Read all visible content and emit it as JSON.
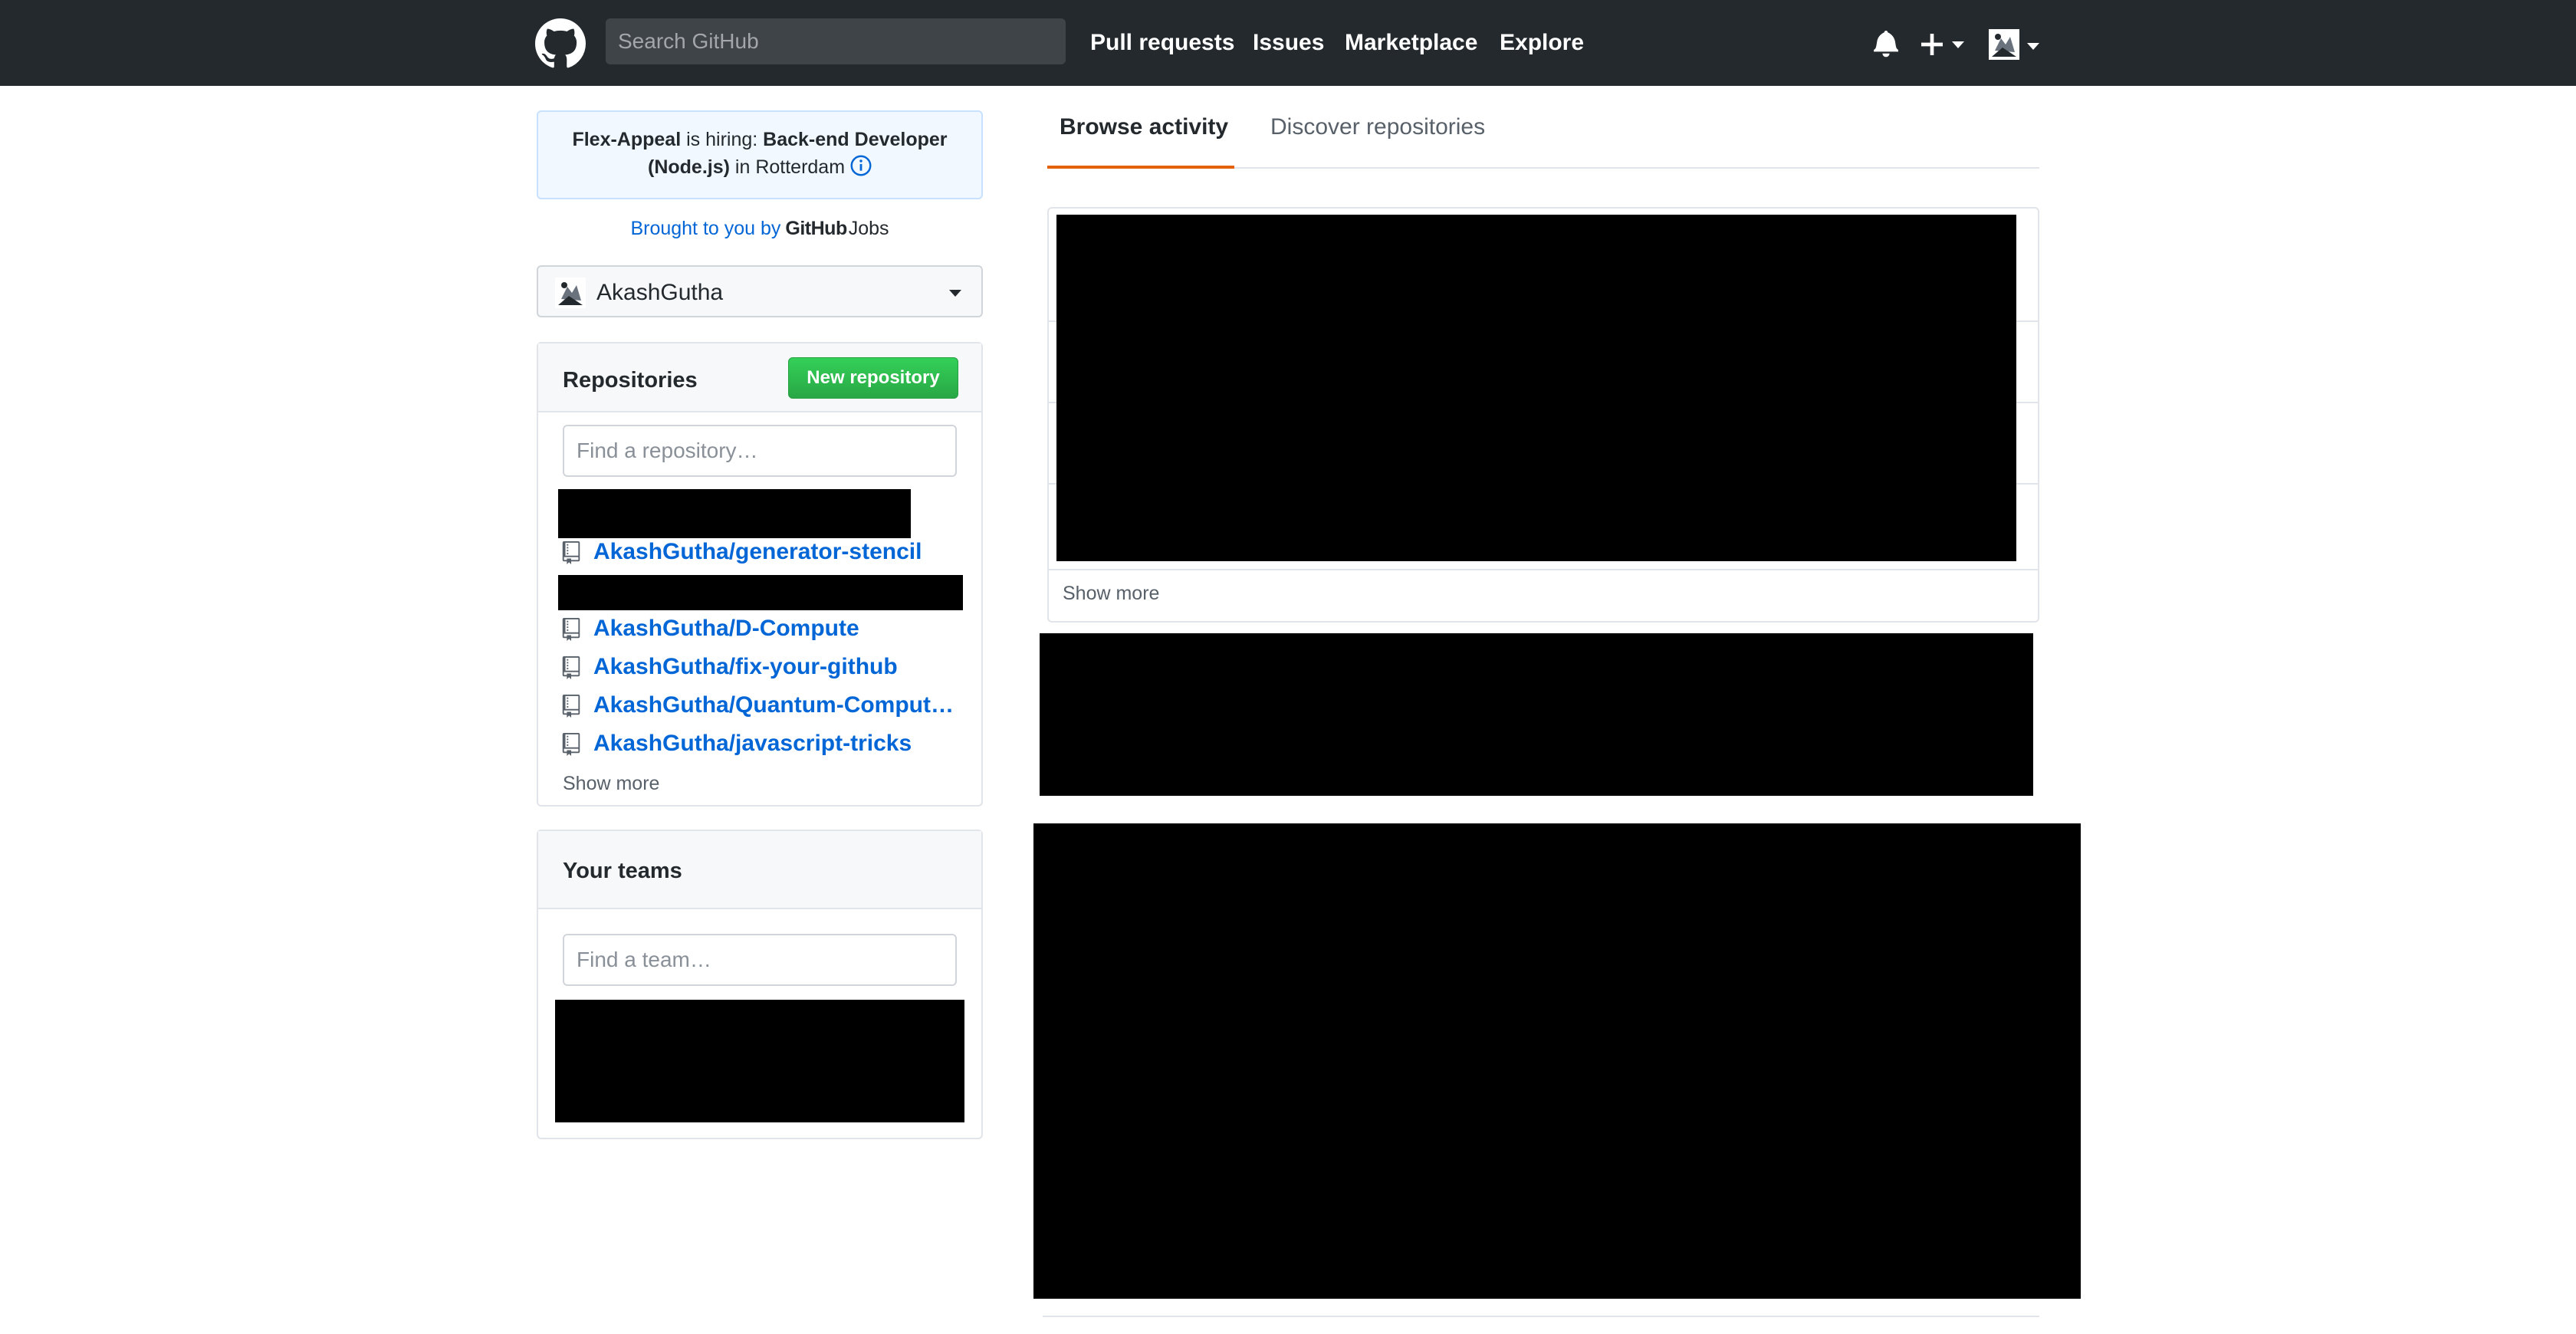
{
  "header": {
    "search_placeholder": "Search GitHub",
    "nav": {
      "pull_requests": "Pull requests",
      "issues": "Issues",
      "marketplace": "Marketplace",
      "explore": "Explore"
    },
    "icons": [
      "github-logo",
      "bell-icon",
      "plus-icon",
      "avatar"
    ]
  },
  "hiring": {
    "company": "Flex-Appeal",
    "is_hiring": "is hiring:",
    "role_line1": "Back-end Developer",
    "role_line2": "(Node.js)",
    "location_prefix": "in",
    "location": "Rotterdam",
    "brought": "Brought to you by",
    "github_brand": "GitHub",
    "jobs_brand": "Jobs"
  },
  "account": {
    "username": "AkashGutha"
  },
  "repositories": {
    "title": "Repositories",
    "new_button": "New repository",
    "filter_placeholder": "Find a repository…",
    "items": [
      "AkashGutha/generator-stencil",
      "AkashGutha/D-Compute",
      "AkashGutha/fix-your-github",
      "AkashGutha/Quantum-Computing-Resources",
      "AkashGutha/javascript-tricks"
    ],
    "show_more": "Show more"
  },
  "teams": {
    "title": "Your teams",
    "filter_placeholder": "Find a team…"
  },
  "activity": {
    "tabs": [
      "Browse activity",
      "Discover repositories"
    ],
    "active_tab": "Browse activity",
    "show_more": "Show more"
  },
  "colors": {
    "header_bg": "#24292e",
    "link": "#0366d6",
    "tab_accent": "#e36209",
    "primary_button": "#28a745",
    "redaction": "#000000"
  }
}
